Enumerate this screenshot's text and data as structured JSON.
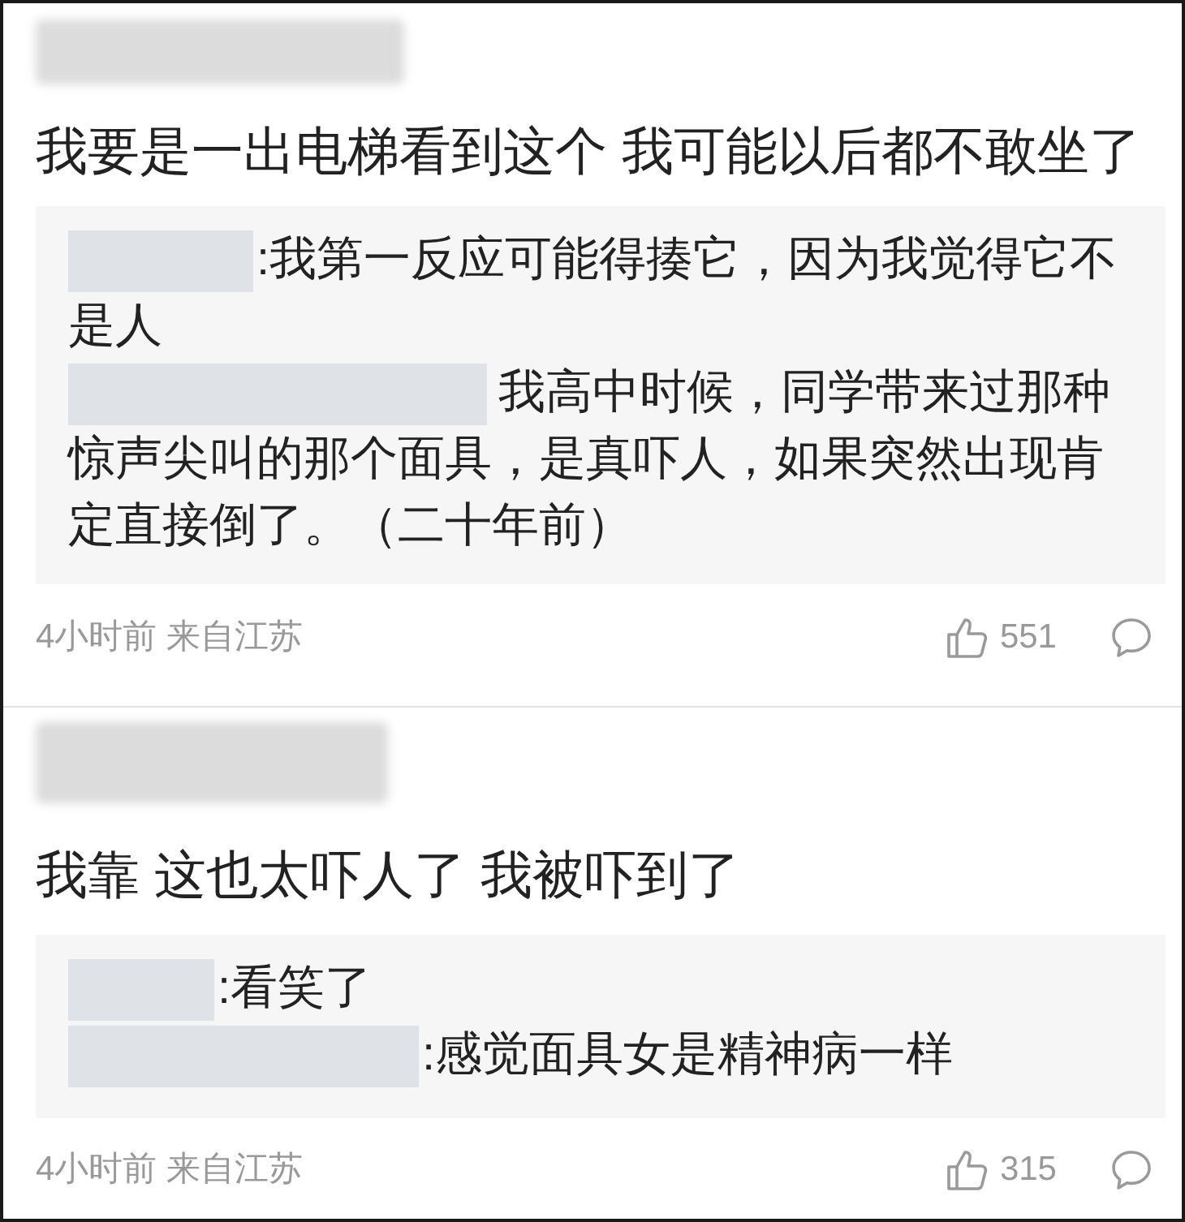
{
  "comments": [
    {
      "text": "我要是一出电梯看到这个 我可能以后都不敢坐了",
      "replies": [
        {
          "text": ":我第一反应可能得揍它，因为我觉得它不是人"
        },
        {
          "text": "我高中时候，同学带来过那种惊声尖叫的那个面具，是真吓人，如果突然出现肯定直接倒了。（二十年前）"
        }
      ],
      "meta": "4小时前 来自江苏",
      "likes": "551"
    },
    {
      "text": "我靠 这也太吓人了 我被吓到了",
      "replies": [
        {
          "text": ":看笑了"
        },
        {
          "text": ":感觉面具女是精神病一样"
        }
      ],
      "meta": "4小时前 来自江苏",
      "likes": "315"
    }
  ]
}
